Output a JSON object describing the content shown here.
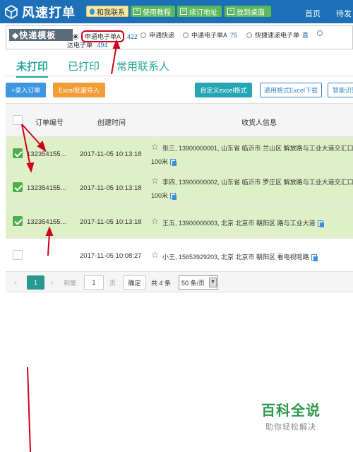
{
  "header": {
    "logo": "风速打单",
    "contact": "和我联系",
    "tutorial": "使用教程",
    "renew": "续订地址",
    "desktop": "放到桌面",
    "nav_home": "首页",
    "nav_other": "待发"
  },
  "templates": {
    "label": "◆快递模板",
    "options": [
      {
        "label": "申通电子单A",
        "count": "422",
        "selected": true
      },
      {
        "label": "申通快递",
        "count": "",
        "selected": false
      },
      {
        "label": "中通电子单A",
        "count": "75",
        "selected": false
      },
      {
        "label": "快捷速递电子单",
        "count": "直",
        "selected": false
      }
    ],
    "line2_label": "达电子单",
    "line2_count": "494"
  },
  "tabs": [
    "未打印",
    "已打印",
    "常用联系人"
  ],
  "toolbar": {
    "add": "+录入订单",
    "excel_import": "Excel批量导入",
    "custom_excel": "自定义excel格式",
    "download": "通用格式Excel下载",
    "smart": "智能识别"
  },
  "table": {
    "headers": [
      "订单编号",
      "创建时间",
      "收货人信息"
    ],
    "rows": [
      {
        "checked": true,
        "no": "132354155...",
        "time": "2017-11-05 10:13:18",
        "info": "张三, 13900000001, 山东省 临沂市 兰山区 解放路与工业大道交汇口",
        "info2": "100米"
      },
      {
        "checked": true,
        "no": "132354155...",
        "time": "2017-11-05 10:13:18",
        "info": "李四, 13900000002, 山东省 临沂市 罗庄区 解放路与工业大道交汇口",
        "info2": "100米"
      },
      {
        "checked": true,
        "no": "132354155...",
        "time": "2017-11-05 10:13:18",
        "info": "王五, 13900000003, 北京 北京市 朝阳区 路与工业大道",
        "info2": ""
      },
      {
        "checked": false,
        "no": "",
        "time": "2017-11-05 10:08:27",
        "info": "小王, 15653929203, 北京 北京市 朝阳区 看电视呢路",
        "info2": ""
      }
    ]
  },
  "pager": {
    "current": "1",
    "goto_label": "到第",
    "page_input": "1",
    "page_unit": "页",
    "confirm": "确定",
    "total": "共 4 条",
    "page_size": "50 条/页"
  },
  "watermark": {
    "title": "百科全说",
    "subtitle": "助你轻松解决"
  },
  "colors": {
    "header_bg": "#1d6fb8",
    "accent": "#26a69a",
    "selected_row": "#dff0c8",
    "annotation": "#d0021b"
  }
}
